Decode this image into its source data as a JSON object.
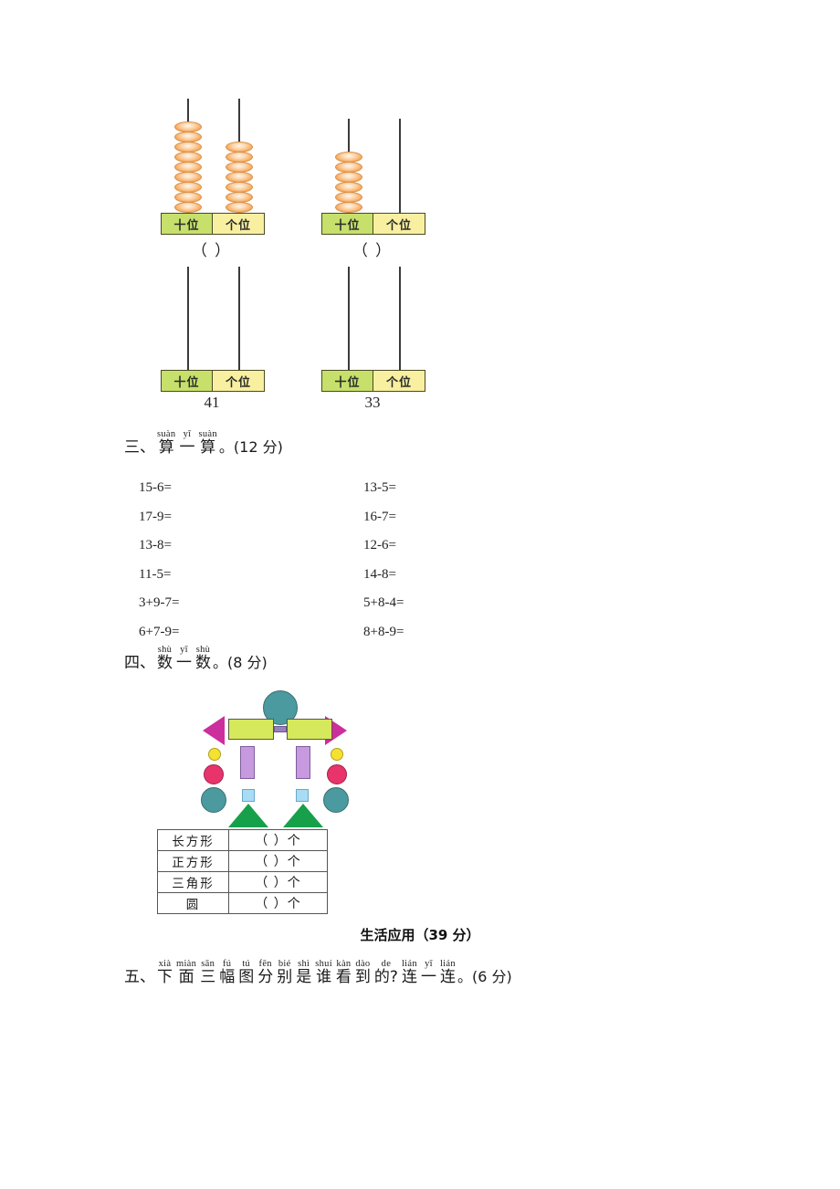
{
  "abacus_top": [
    {
      "id": "abacus-1",
      "tens_beads": 9,
      "ones_beads": 7,
      "tens_label": "十位",
      "ones_label": "个位",
      "answer": "（        ）"
    },
    {
      "id": "abacus-2",
      "tens_beads": 6,
      "ones_beads": 0,
      "tens_label": "十位",
      "ones_label": "个位",
      "answer": "（        ）"
    }
  ],
  "abacus_bottom": [
    {
      "id": "abacus-3",
      "tens_beads": 0,
      "ones_beads": 0,
      "tens_label": "十位",
      "ones_label": "个位",
      "number": "41"
    },
    {
      "id": "abacus-4",
      "tens_beads": 0,
      "ones_beads": 0,
      "tens_label": "十位",
      "ones_label": "个位",
      "number": "33"
    }
  ],
  "section_three": {
    "index": "三、",
    "words": [
      {
        "pinyin": "suàn",
        "hanzi": "算"
      },
      {
        "pinyin": "yī",
        "hanzi": "一"
      },
      {
        "pinyin": "suàn",
        "hanzi": "算"
      }
    ],
    "tail": "。(12 分)"
  },
  "arithmetic": {
    "left_column": [
      "15-6=",
      "17-9=",
      "13-8=",
      "11-5=",
      "3+9-7=",
      "6+7-9="
    ],
    "right_column": [
      "13-5=",
      "16-7=",
      "12-6=",
      "14-8=",
      "5+8-4=",
      "8+8-9="
    ]
  },
  "section_four": {
    "index": "四、",
    "words": [
      {
        "pinyin": "shù",
        "hanzi": "数"
      },
      {
        "pinyin": "yī",
        "hanzi": "一"
      },
      {
        "pinyin": "shù",
        "hanzi": "数"
      }
    ],
    "tail": "。(8 分)"
  },
  "count_table": {
    "rows": [
      {
        "name": "长方形",
        "value": "（        ）个"
      },
      {
        "name": "正方形",
        "value": "（        ）个"
      },
      {
        "name": "三角形",
        "value": "（        ）个"
      },
      {
        "name": "圆",
        "value": "（        ）个"
      }
    ]
  },
  "banner": {
    "title": "生活应用",
    "points": "（39 分）"
  },
  "section_five": {
    "index": "五、",
    "words": [
      {
        "pinyin": "xià",
        "hanzi": "下"
      },
      {
        "pinyin": "miàn",
        "hanzi": "面"
      },
      {
        "pinyin": "sān",
        "hanzi": "三"
      },
      {
        "pinyin": "fú",
        "hanzi": "幅"
      },
      {
        "pinyin": "tú",
        "hanzi": "图"
      },
      {
        "pinyin": "fēn",
        "hanzi": "分"
      },
      {
        "pinyin": "bié",
        "hanzi": "别"
      },
      {
        "pinyin": "shì",
        "hanzi": "是"
      },
      {
        "pinyin": "shuí",
        "hanzi": "谁"
      },
      {
        "pinyin": "kàn",
        "hanzi": "看"
      },
      {
        "pinyin": "dào",
        "hanzi": "到"
      },
      {
        "pinyin": "de",
        "hanzi": "的?"
      },
      {
        "pinyin": "lián",
        "hanzi": "连"
      },
      {
        "pinyin": "yī",
        "hanzi": "一"
      },
      {
        "pinyin": "lián",
        "hanzi": "连"
      }
    ],
    "tail": "。(6 分)"
  },
  "robot_figure": {
    "colors": {
      "head_teal": "#4a9aa0",
      "arm_magenta": "#cc2e9c",
      "body_yellowgreen": "#d6e85c",
      "connector_purple": "#9a7fc0",
      "small_yellow": "#f5e230",
      "pink": "#e8346b",
      "purple_rect": "#c79ae0",
      "light_blue": "#a8dcf5",
      "green_tri": "#17a04a"
    }
  }
}
